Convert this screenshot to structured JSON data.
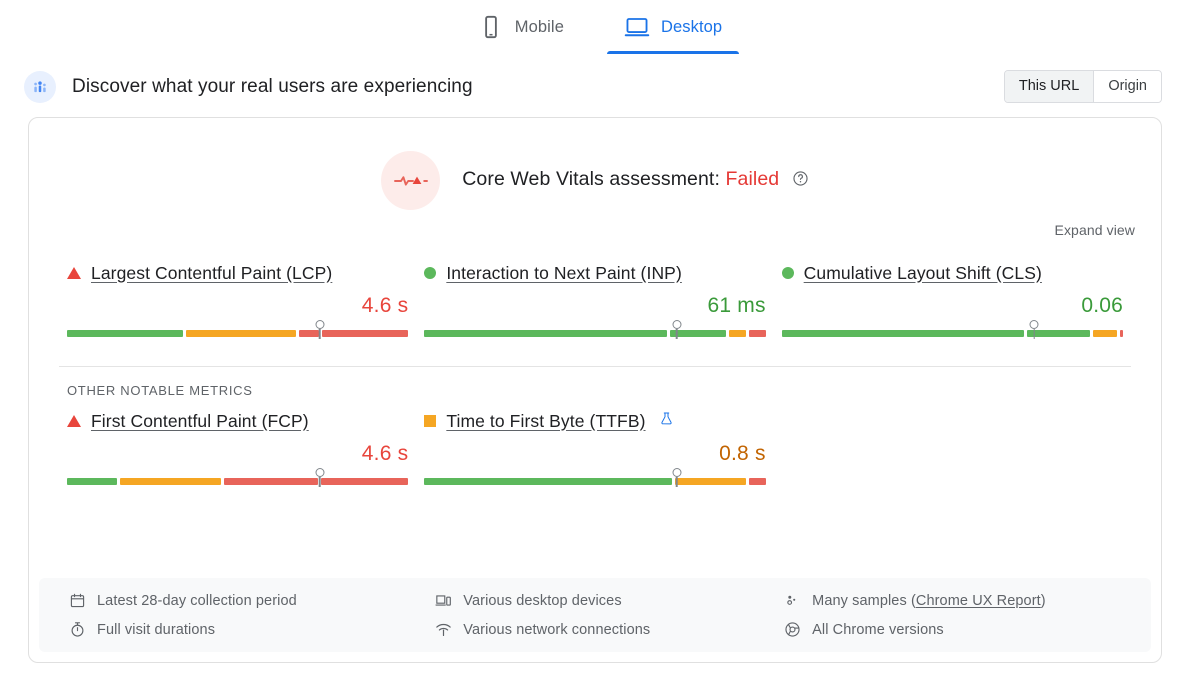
{
  "form_factor_tabs": [
    {
      "label": "Mobile",
      "icon": "mobile-icon",
      "active": false
    },
    {
      "label": "Desktop",
      "icon": "desktop-icon",
      "active": true
    }
  ],
  "discover": {
    "title": "Discover what your real users are experiencing",
    "icon": "users-chart-icon"
  },
  "scope_toggle": {
    "options": [
      "This URL",
      "Origin"
    ],
    "selected": "This URL"
  },
  "assessment": {
    "label": "Core Web Vitals assessment:",
    "status": "Failed",
    "status_color": "#e53935",
    "badge_icon": "pulse-alert-icon",
    "help_icon": "help-circle-icon"
  },
  "expand_view": "Expand view",
  "other_metrics_title": "OTHER NOTABLE METRICS",
  "colors": {
    "good": "#5cb85c",
    "needs_improvement": "#f5a623",
    "poor": "#e8645a",
    "accent": "#1a73e8",
    "fail_text": "#e53935"
  },
  "core_web_vitals": [
    {
      "name": "Largest Contentful Paint (LCP)",
      "value": "4.6 s",
      "rating": "poor",
      "marker": "triangle",
      "value_class": "v-red",
      "needle_pct": 74,
      "segments": [
        {
          "color": "good",
          "pct": 35
        },
        {
          "color": "needs_improvement",
          "pct": 33
        },
        {
          "color": "poor",
          "pct": 6
        },
        {
          "color": "poor",
          "pct": 26
        }
      ]
    },
    {
      "name": "Interaction to Next Paint (INP)",
      "value": "61 ms",
      "rating": "good",
      "marker": "dot",
      "value_class": "v-green",
      "needle_pct": 74,
      "segments": [
        {
          "color": "good",
          "pct": 73
        },
        {
          "color": "good",
          "pct": 17
        },
        {
          "color": "needs_improvement",
          "pct": 5
        },
        {
          "color": "poor",
          "pct": 5
        }
      ]
    },
    {
      "name": "Cumulative Layout Shift (CLS)",
      "value": "0.06",
      "rating": "good",
      "marker": "dot",
      "value_class": "v-green",
      "needle_pct": 74,
      "segments": [
        {
          "color": "good",
          "pct": 73
        },
        {
          "color": "good",
          "pct": 19
        },
        {
          "color": "needs_improvement",
          "pct": 7
        },
        {
          "color": "poor",
          "pct": 1
        }
      ]
    }
  ],
  "other_metrics": [
    {
      "name": "First Contentful Paint (FCP)",
      "value": "4.6 s",
      "rating": "poor",
      "marker": "triangle",
      "value_class": "v-red",
      "needle_pct": 74,
      "experimental": false,
      "segments": [
        {
          "color": "good",
          "pct": 15
        },
        {
          "color": "needs_improvement",
          "pct": 30
        },
        {
          "color": "poor",
          "pct": 28
        },
        {
          "color": "poor",
          "pct": 26
        }
      ]
    },
    {
      "name": "Time to First Byte (TTFB)",
      "value": "0.8 s",
      "rating": "needs_improvement",
      "marker": "square",
      "value_class": "v-orange",
      "needle_pct": 74,
      "experimental": true,
      "experimental_icon": "flask-icon",
      "segments": [
        {
          "color": "good",
          "pct": 73
        },
        {
          "color": "needs_improvement",
          "pct": 21
        },
        {
          "color": "poor",
          "pct": 5
        }
      ]
    }
  ],
  "meta": [
    {
      "icon": "calendar-icon",
      "text": "Latest 28-day collection period"
    },
    {
      "icon": "devices-icon",
      "text": "Various desktop devices"
    },
    {
      "icon": "samples-icon",
      "text": "Many samples (",
      "link": "Chrome UX Report",
      "text_after": ")"
    },
    {
      "icon": "stopwatch-icon",
      "text": "Full visit durations"
    },
    {
      "icon": "network-icon",
      "text": "Various network connections"
    },
    {
      "icon": "chrome-icon",
      "text": "All Chrome versions"
    }
  ]
}
